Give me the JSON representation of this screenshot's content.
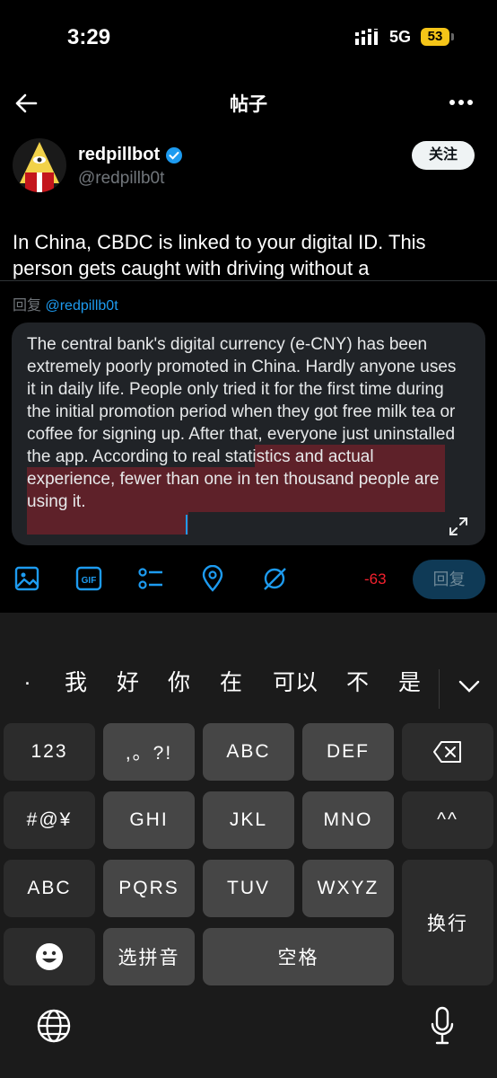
{
  "status_bar": {
    "time": "3:29",
    "network": "5G",
    "battery": "53"
  },
  "header": {
    "title": "帖子",
    "back_icon": "arrow-left-icon",
    "more_icon": "more-dots-icon"
  },
  "profile": {
    "name": "redpillbot",
    "handle": "@redpillb0t",
    "verified": true,
    "follow_label": "关注"
  },
  "tweet": {
    "text": "In China, CBDC is linked to your digital ID. This person gets caught with driving without a"
  },
  "reply": {
    "prefix": "回复",
    "mention": "@redpillb0t"
  },
  "compose": {
    "text": "The central bank's digital currency (e-CNY) has been extremely poorly promoted in China. Hardly anyone uses it in daily life. People only tried it for the first time during the initial promotion period when they got free milk tea or coffee for signing up. After that, everyone just uninstalled the app. According to real statistics and actual experience, fewer than one in ten thousand people are using it.",
    "highlight_color": "#5e2129"
  },
  "toolbar": {
    "icons": [
      "image-icon",
      "gif-icon",
      "poll-icon",
      "location-icon",
      "grok-icon"
    ],
    "char_count": "-63",
    "reply_label": "回复",
    "accent": "#1d9bf0"
  },
  "keyboard": {
    "candidates": [
      ".",
      "我",
      "好",
      "你",
      "在",
      "可以",
      "不",
      "是"
    ],
    "rows": {
      "r1": [
        "123",
        ",。?!",
        "ABC",
        "DEF"
      ],
      "r2": [
        "#@¥",
        "GHI",
        "JKL",
        "MNO",
        "^^"
      ],
      "r3": [
        "ABC",
        "PQRS",
        "TUV",
        "WXYZ"
      ],
      "r4": [
        "选拼音",
        "空格"
      ],
      "enter": "换行"
    }
  }
}
